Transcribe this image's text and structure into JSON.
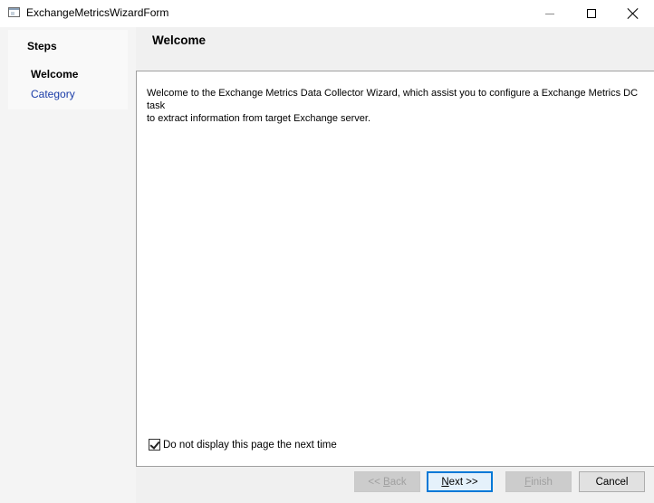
{
  "window": {
    "title": "ExchangeMetricsWizardForm",
    "controls": {
      "minimize": "minimize",
      "maximize": "maximize",
      "close": "close"
    }
  },
  "steps": {
    "header": "Steps",
    "items": [
      {
        "label": "Welcome",
        "state": "current"
      },
      {
        "label": "Category",
        "state": "link"
      }
    ]
  },
  "page": {
    "title": "Welcome",
    "description": "Welcome to the Exchange Metrics Data Collector Wizard, which assist you to configure a Exchange Metrics DC task\nto extract information from target Exchange server.",
    "checkbox": {
      "label": "Do not display this page the next time",
      "checked": true
    }
  },
  "buttons": {
    "back": {
      "prefix": "<< ",
      "mnemonic": "B",
      "rest": "ack",
      "enabled": false
    },
    "next": {
      "mnemonic": "N",
      "rest": "ext >>",
      "enabled": true
    },
    "finish": {
      "mnemonic": "F",
      "rest": "inish",
      "enabled": false
    },
    "cancel": {
      "label": "Cancel",
      "enabled": true
    }
  },
  "colors": {
    "link": "#1a3ca8",
    "focus": "#0078d7"
  }
}
